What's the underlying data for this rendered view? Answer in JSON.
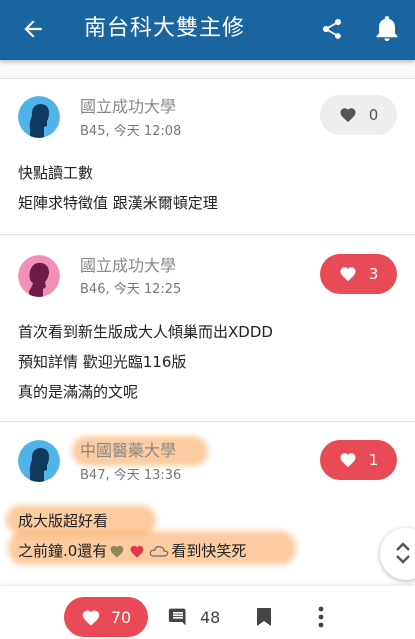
{
  "appbar": {
    "title": "南台科大雙主修",
    "back_icon": "arrow-left-icon",
    "share_icon": "share-icon",
    "bell_icon": "bell-icon"
  },
  "colors": {
    "primary": "#1a64a0",
    "like_active": "#e84b55",
    "like_inactive": "#eeeeee",
    "highlight": "#f5a050"
  },
  "posts": [
    {
      "school": "國立成功大學",
      "floor_time": "B45, 今天 12:08",
      "likes": "0",
      "liked": false,
      "avatar": "male-avatar",
      "lines": [
        "快點讀工數",
        "矩陣求特徵值 跟漢米爾頓定理"
      ]
    },
    {
      "school": "國立成功大學",
      "floor_time": "B46, 今天 12:25",
      "likes": "3",
      "liked": true,
      "avatar": "female-avatar",
      "lines": [
        "首次看到新生版成大人傾巢而出XDDD",
        "預知詳情 歡迎光臨116版",
        "真的是滿滿的文呢"
      ]
    },
    {
      "school": "中國醫藥大學",
      "floor_time": "B47, 今天 13:36",
      "likes": "1",
      "liked": true,
      "avatar": "male-avatar",
      "lines": [
        "成大版超好看",
        "之前鐘.0還有",
        "看到快笑死"
      ]
    }
  ],
  "bottom": {
    "likes": "70",
    "comments": "48"
  }
}
